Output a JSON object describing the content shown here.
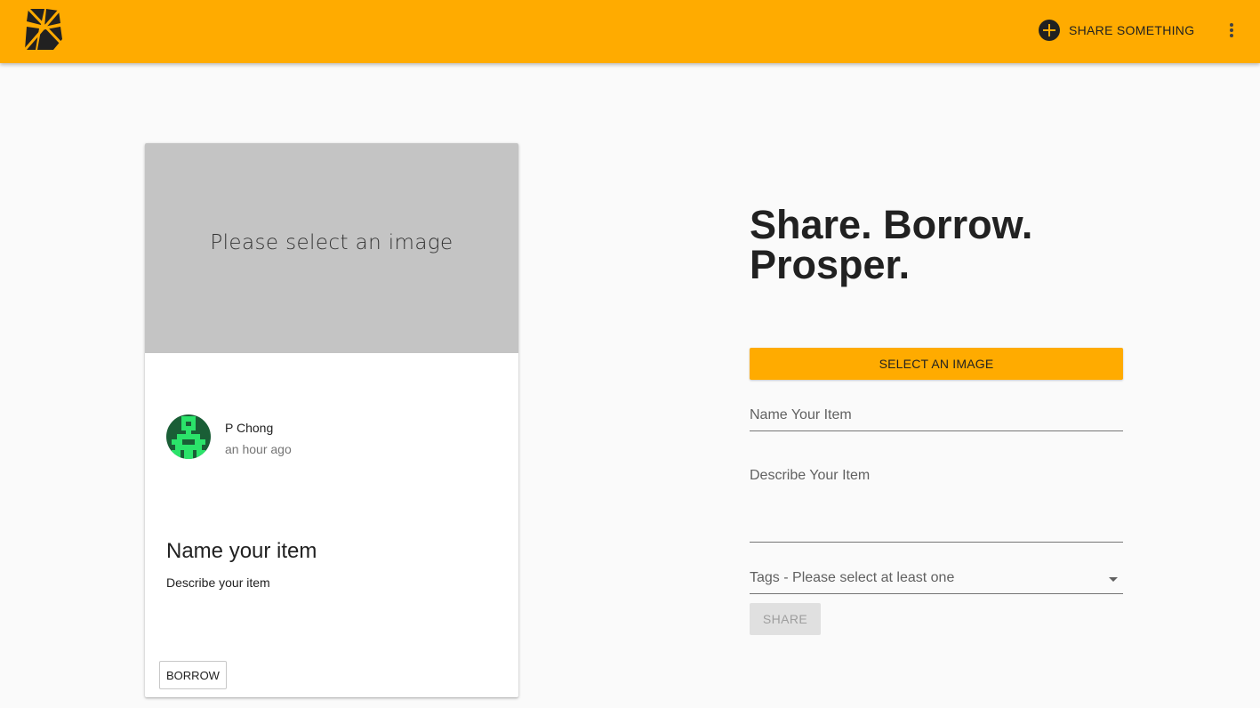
{
  "header": {
    "share_label": "SHARE SOMETHING",
    "accent_color": "#ffab00",
    "logo_icon": "boomtown-logo-icon",
    "share_icon": "plus-circle-icon",
    "menu_icon": "more-vert-icon"
  },
  "preview_card": {
    "image_placeholder": "Please select an image",
    "owner": {
      "name": "P Chong",
      "time": "an hour ago",
      "avatar_icon": "identicon-avatar"
    },
    "item_title": "Name your item",
    "item_description": "Describe your item",
    "borrow_label": "BORROW"
  },
  "form": {
    "headline": "Share. Borrow. Prosper.",
    "select_image_label": "SELECT AN IMAGE",
    "name_placeholder": "Name Your Item",
    "description_placeholder": "Describe Your Item",
    "tags_placeholder": "Tags - Please select at least one",
    "share_label": "SHARE",
    "share_disabled": true
  }
}
